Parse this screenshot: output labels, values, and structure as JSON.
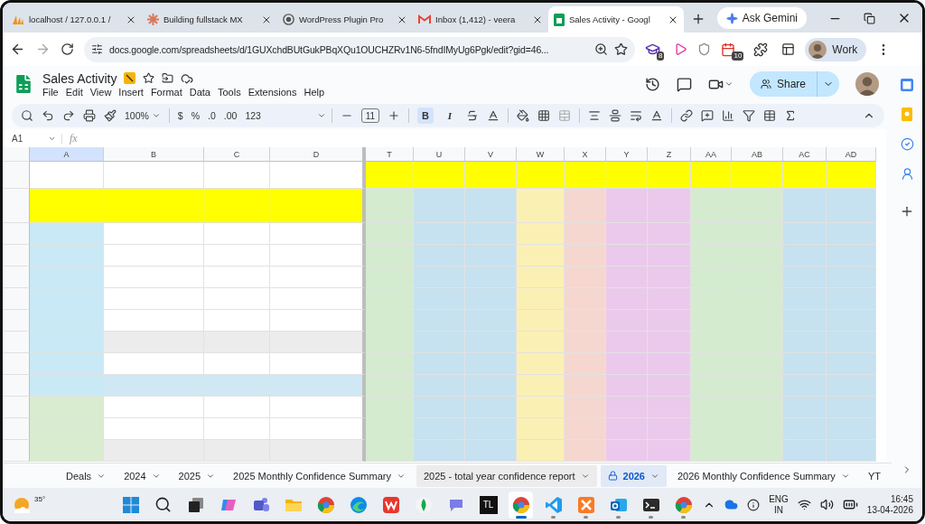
{
  "browser_tabs": [
    {
      "kind": "sails",
      "title": "localhost / 127.0.0.1 /",
      "selected": false
    },
    {
      "kind": "asterisk",
      "title": "Building fullstack MX",
      "selected": false
    },
    {
      "kind": "wp",
      "title": "WordPress Plugin Pro",
      "selected": false
    },
    {
      "kind": "mail",
      "title": "Inbox (1,412) - veera",
      "selected": false
    },
    {
      "kind": "sheet",
      "title": "Sales Activity - Googl",
      "selected": true
    }
  ],
  "gemini": {
    "label": "Ask Gemini"
  },
  "address": {
    "url": "docs.google.com/spreadsheets/d/1GUXchdBUtGukPBqXQu1OUCHZRv1N6-5fndIMyUg6Pgk/edit?gid=46..."
  },
  "extensions": [
    {
      "kind": "cap",
      "badge": "8"
    },
    {
      "kind": "arrow"
    },
    {
      "kind": "shield"
    },
    {
      "kind": "calendar",
      "badge": "10"
    },
    {
      "kind": "puzzle"
    }
  ],
  "profile": {
    "label": "Work"
  },
  "doc": {
    "title": "Sales Activity",
    "menus": [
      "File",
      "Edit",
      "View",
      "Insert",
      "Format",
      "Data",
      "Tools",
      "Extensions",
      "Help"
    ],
    "share": "Share"
  },
  "toolbar": {
    "zoom": "100%",
    "currency": "$",
    "percent": "%",
    "decrease_decimal": ".0",
    "increase_decimal": ".00",
    "number_format": "123",
    "font_size": "11",
    "bold": {
      "label": "B",
      "on": true
    },
    "italic": {
      "label": "I",
      "on": false
    }
  },
  "formula_bar": {
    "cell": "A1",
    "fx": "fx"
  },
  "columns": [
    {
      "label": "A",
      "selected": true
    },
    {
      "label": "B",
      "selected": false
    },
    {
      "label": "C",
      "selected": false
    },
    {
      "label": "D",
      "selected": false
    },
    {
      "label": "T",
      "selected": false
    },
    {
      "label": "U",
      "selected": false
    },
    {
      "label": "V",
      "selected": false
    },
    {
      "label": "W",
      "selected": false
    },
    {
      "label": "X",
      "selected": false
    },
    {
      "label": "Y",
      "selected": false
    },
    {
      "label": "Z",
      "selected": false
    },
    {
      "label": "AA",
      "selected": false
    },
    {
      "label": "AB",
      "selected": false
    },
    {
      "label": "AC",
      "selected": false
    },
    {
      "label": "AD",
      "selected": false
    }
  ],
  "rows": [
    {
      "kind": "title"
    },
    {
      "kind": "header"
    },
    {
      "kind": "data"
    },
    {
      "kind": "data"
    },
    {
      "kind": "data"
    },
    {
      "kind": "data"
    },
    {
      "kind": "data"
    },
    {
      "kind": "subtotal"
    },
    {
      "kind": "data"
    },
    {
      "kind": "total"
    },
    {
      "kind": "data2"
    },
    {
      "kind": "data2"
    },
    {
      "kind": "subtotal2"
    }
  ],
  "sheet_tabs": [
    {
      "label": "Deals",
      "selected": false,
      "hovered": false,
      "locked": false
    },
    {
      "label": "2024",
      "selected": false,
      "hovered": false,
      "locked": false
    },
    {
      "label": "2025",
      "selected": false,
      "hovered": false,
      "locked": false
    },
    {
      "label": "2025 Monthly Confidence Summary",
      "selected": false,
      "hovered": false,
      "locked": false
    },
    {
      "label": "2025 - total year confidence report",
      "selected": false,
      "hovered": true,
      "locked": false
    },
    {
      "label": "2026",
      "selected": true,
      "hovered": false,
      "locked": true
    },
    {
      "label": "2026 Monthly Confidence Summary",
      "selected": false,
      "hovered": false,
      "locked": false
    },
    {
      "label": "YT",
      "selected": false,
      "hovered": false,
      "locked": false
    }
  ],
  "taskbar": {
    "weather": "35°",
    "apps": [
      {
        "kind": "start",
        "running": false,
        "active": false
      },
      {
        "kind": "search",
        "running": false,
        "active": false
      },
      {
        "kind": "taskview",
        "running": false,
        "active": false
      },
      {
        "kind": "copilot",
        "running": false,
        "active": false
      },
      {
        "kind": "teams",
        "running": false,
        "active": false
      },
      {
        "kind": "folder",
        "running": false,
        "active": false
      },
      {
        "kind": "chrome",
        "running": false,
        "active": false
      },
      {
        "kind": "edge",
        "running": false,
        "active": false
      },
      {
        "kind": "wps",
        "running": false,
        "active": false
      },
      {
        "kind": "leaf",
        "running": false,
        "active": false
      },
      {
        "kind": "chat",
        "running": false,
        "active": false
      },
      {
        "kind": "text",
        "label": "TL",
        "running": false,
        "active": false
      },
      {
        "kind": "chrome",
        "running": true,
        "active": true
      },
      {
        "kind": "vscode",
        "running": true,
        "active": false
      },
      {
        "kind": "xampp",
        "running": true,
        "active": false
      },
      {
        "kind": "outlook",
        "running": true,
        "active": false
      },
      {
        "kind": "terminal",
        "running": true,
        "active": false
      },
      {
        "kind": "chrome",
        "running": true,
        "active": false
      }
    ],
    "language": "ENG",
    "region": "IN",
    "time": "16:45",
    "date": "13-04-2026"
  }
}
